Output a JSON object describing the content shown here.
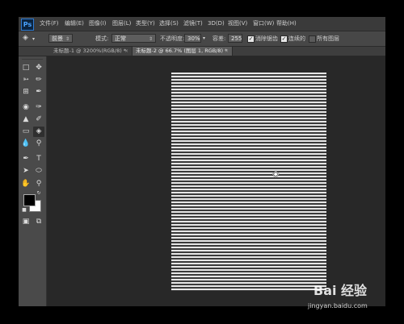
{
  "app": {
    "logo": "Ps"
  },
  "menu": [
    "文件(F)",
    "编辑(E)",
    "图像(I)",
    "图层(L)",
    "类型(Y)",
    "选择(S)",
    "滤镜(T)",
    "3D(D)",
    "视图(V)",
    "窗口(W)",
    "帮助(H)"
  ],
  "options": {
    "tool_icon": "paint-bucket-icon",
    "source_select": "前景",
    "mode_label": "模式:",
    "mode_select": "正常",
    "opacity_label": "不透明度:",
    "opacity_value": "30%",
    "tolerance_label": "容差:",
    "tolerance_value": "255",
    "antialias_label": "消除锯齿",
    "antialias_checked": true,
    "contiguous_label": "连续的",
    "contiguous_checked": true,
    "all_layers_label": "所有图层",
    "all_layers_checked": false
  },
  "tabs": [
    {
      "label": "未标题-1 @ 3200%(RGB/8) *",
      "active": false
    },
    {
      "label": "未标题-2 @ 66.7% (图层 1, RGB/8) *",
      "active": true
    }
  ],
  "colors": {
    "foreground": "#000000",
    "background": "#ffffff",
    "workspace": "#282828",
    "panel": "#535353"
  },
  "tools": [
    "move-icon",
    "marquee-icon",
    "lasso-icon",
    "quick-select-icon",
    "crop-icon",
    "eyedropper-icon",
    "spot-heal-icon",
    "brush-icon",
    "clone-stamp-icon",
    "history-brush-icon",
    "eraser-icon",
    "paint-bucket-icon",
    "blur-icon",
    "dodge-icon",
    "pen-icon",
    "type-icon",
    "path-select-icon",
    "shape-icon",
    "hand-icon",
    "zoom-icon",
    "quick-mask-icon",
    "screen-mode-icon"
  ],
  "watermark": {
    "logo": "Bai 经验",
    "url": "jingyan.baidu.com"
  }
}
